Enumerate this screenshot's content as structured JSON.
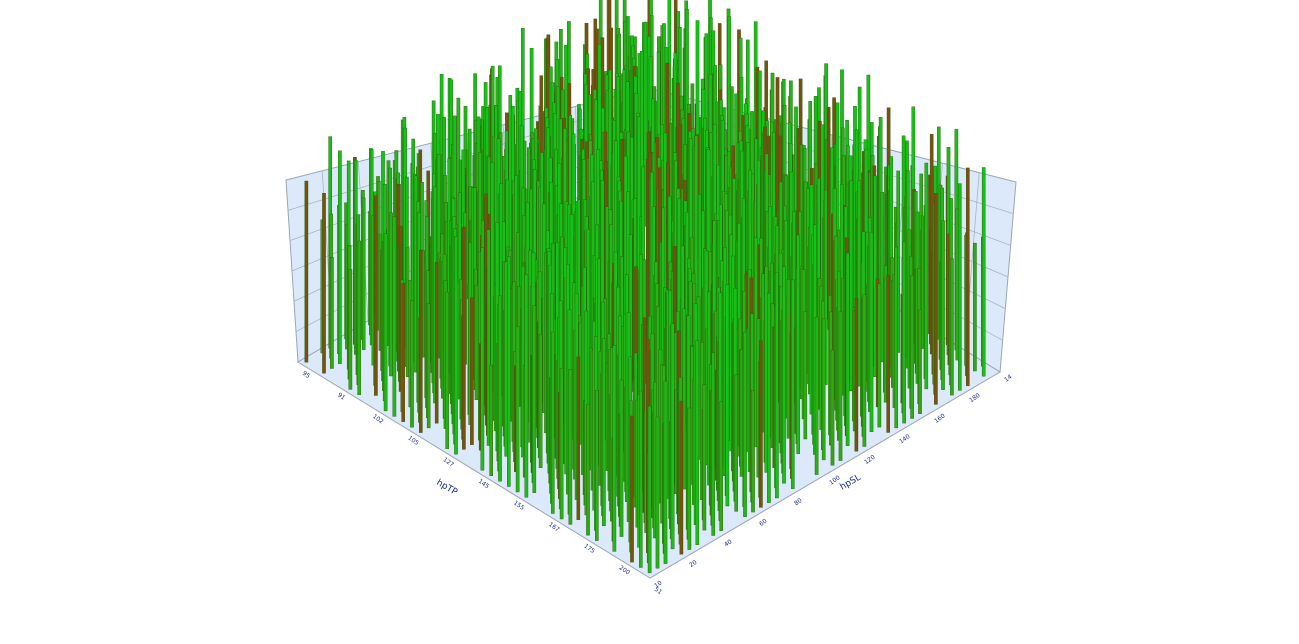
{
  "chart_data": {
    "type": "bar3d",
    "title": "",
    "xlabel": "hpTP",
    "ylabel": "hpSL",
    "zlabel": "",
    "x_ticks": [
      "95",
      "91",
      "102",
      "105",
      "127",
      "145",
      "155",
      "167",
      "175",
      "200",
      "51"
    ],
    "y_ticks": [
      "10",
      "20",
      "40",
      "60",
      "80",
      "100",
      "120",
      "140",
      "160",
      "180",
      "14"
    ],
    "grid": true,
    "wall_color": "#dbe9fa",
    "grid_color": "#a8b4c4",
    "bar_colors": {
      "low": "#4f8a10",
      "high": "#12c41a",
      "mid_dark": "#7a5010"
    },
    "axis_text_color": "#1a2a8a",
    "bar_heights_grid_description": "dense grid of thin 3D bars; values mostly 0.45–1.0 of max",
    "rows": 40,
    "cols": 44
  }
}
